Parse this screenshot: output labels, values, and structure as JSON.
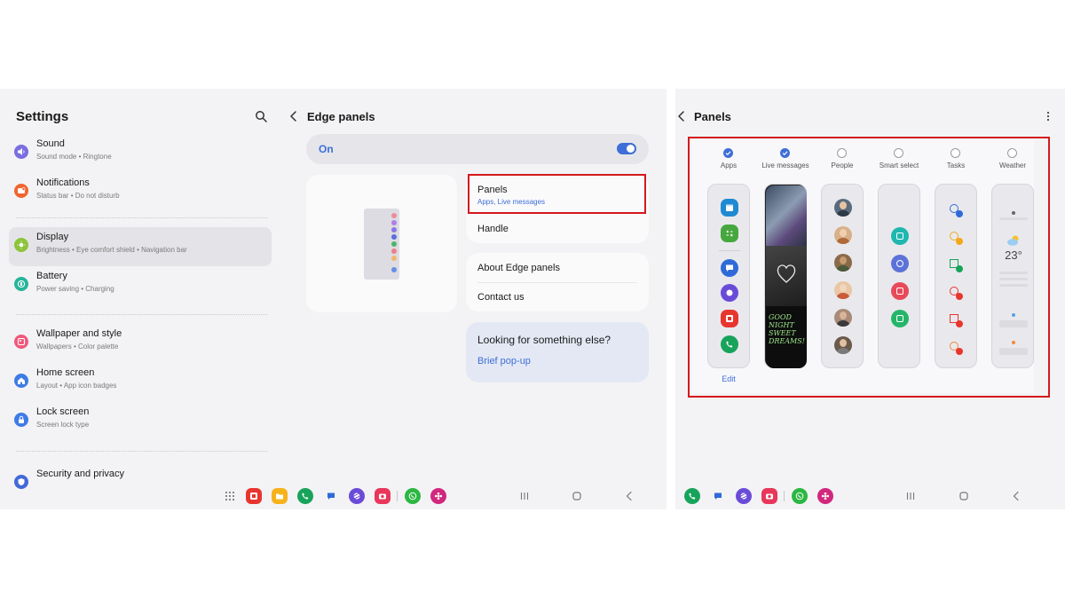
{
  "settings": {
    "title": "Settings",
    "items": [
      {
        "title": "Sound",
        "subtitle": "Sound mode  •  Ringtone",
        "icon": "sound-icon",
        "color": "#7a6ee0"
      },
      {
        "title": "Notifications",
        "subtitle": "Status bar  •  Do not disturb",
        "icon": "notifications-icon",
        "color": "#f0652f"
      },
      {
        "title": "Display",
        "subtitle": "Brightness  •  Eye comfort shield  •  Navigation bar",
        "icon": "display-icon",
        "color": "#8bc43a"
      },
      {
        "title": "Battery",
        "subtitle": "Power saving  •  Charging",
        "icon": "battery-icon",
        "color": "#27b59a"
      },
      {
        "title": "Wallpaper and style",
        "subtitle": "Wallpapers  •  Color palette",
        "icon": "wallpaper-icon",
        "color": "#ef5a7c"
      },
      {
        "title": "Home screen",
        "subtitle": "Layout  •  App icon badges",
        "icon": "home-icon",
        "color": "#3f7be6"
      },
      {
        "title": "Lock screen",
        "subtitle": "Screen lock type",
        "icon": "lock-icon",
        "color": "#3f7be6"
      },
      {
        "title": "Security and privacy",
        "subtitle": "",
        "icon": "security-icon",
        "color": "#4469d8"
      }
    ]
  },
  "edge_panels": {
    "title": "Edge panels",
    "toggle_label": "On",
    "toggle_on": true,
    "panels_label": "Panels",
    "panels_sub": "Apps, Live messages",
    "handle_label": "Handle",
    "about_label": "About Edge panels",
    "contact_label": "Contact us",
    "suggest_title": "Looking for something else?",
    "suggest_link": "Brief pop-up"
  },
  "panels_page": {
    "title": "Panels",
    "panels": [
      {
        "label": "Apps",
        "selected": true
      },
      {
        "label": "Live messages",
        "selected": true
      },
      {
        "label": "People",
        "selected": false
      },
      {
        "label": "Smart select",
        "selected": false
      },
      {
        "label": "Tasks",
        "selected": false
      },
      {
        "label": "Weather",
        "selected": false
      }
    ],
    "edit_label": "Edit",
    "weather_temp": "23°",
    "live_message_text": "GOOD NIGHT SWEET DREAMS!"
  },
  "colors": {
    "accent": "#3e6ed8",
    "highlight": "#d4191d"
  }
}
